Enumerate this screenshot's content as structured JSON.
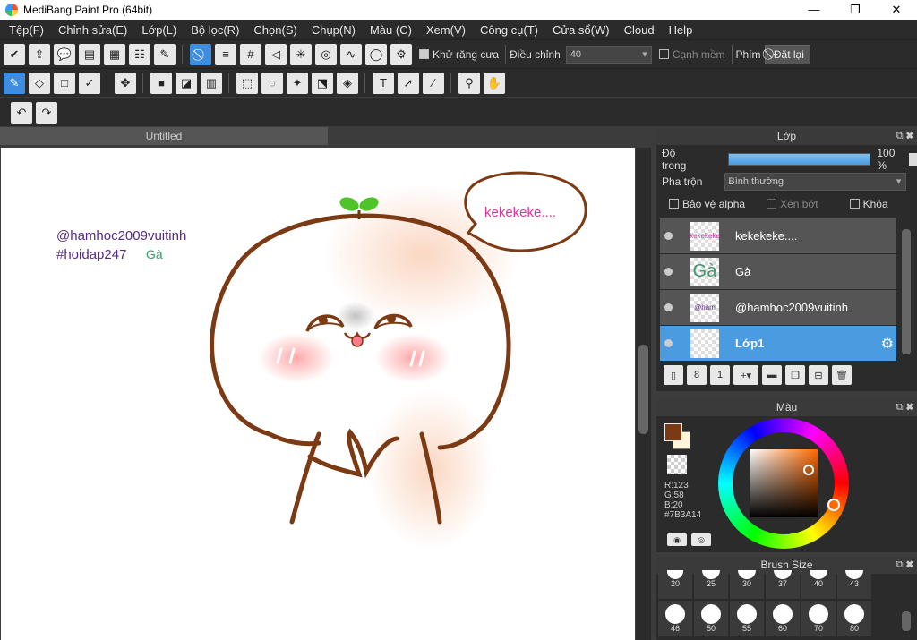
{
  "window": {
    "title": "MediBang Paint Pro (64bit)",
    "minimize": "—",
    "maximize": "❐",
    "close": "✕"
  },
  "menu": [
    "Tệp(F)",
    "Chỉnh sửa(E)",
    "Lớp(L)",
    "Bộ lọc(R)",
    "Chọn(S)",
    "Chụp(N)",
    "Màu (C)",
    "Xem(V)",
    "Công cụ(T)",
    "Cửa sổ(W)",
    "Cloud",
    "Help"
  ],
  "toolbar1": {
    "antialias_label": "Khử răng cưa",
    "adjust_label": "Điều chỉnh",
    "adjust_value": "40",
    "soft_edge_label": "Cạnh mềm",
    "key_label": "Phím",
    "reset_label": "Đặt lại"
  },
  "document": {
    "tab_title": "Untitled"
  },
  "canvas_texts": {
    "handle": "@hamhoc2009vuitinh",
    "hashtag": "#hoidap247",
    "ga": "Gà",
    "bubble": "kekekeke...."
  },
  "layer_panel": {
    "title": "Lớp",
    "opacity_label": "Độ trong",
    "opacity_value": "100 %",
    "blend_label": "Pha trộn",
    "blend_value": "Bình thường",
    "protect_alpha": "Bảo vệ alpha",
    "clipping": "Xén bớt",
    "lock": "Khóa",
    "layers": [
      {
        "name": "kekekeke....",
        "thumb": "kekekeke"
      },
      {
        "name": "Gà",
        "thumb": "Gà"
      },
      {
        "name": "@hamhoc2009vuitinh",
        "thumb": "@ham"
      },
      {
        "name": "Lớp1",
        "thumb": ""
      }
    ]
  },
  "color_panel": {
    "title": "Màu",
    "r": "R:123",
    "g": "G:58",
    "b": "B:20",
    "hex": "#7B3A14",
    "fg_color": "#7b3a14",
    "bg_color": "#fff6d8"
  },
  "brush_panel": {
    "title": "Brush Size",
    "sizes_row1": [
      "20",
      "25",
      "30",
      "37",
      "40",
      "43"
    ],
    "sizes_row2": [
      "46",
      "50",
      "55",
      "60",
      "70",
      "80"
    ]
  }
}
